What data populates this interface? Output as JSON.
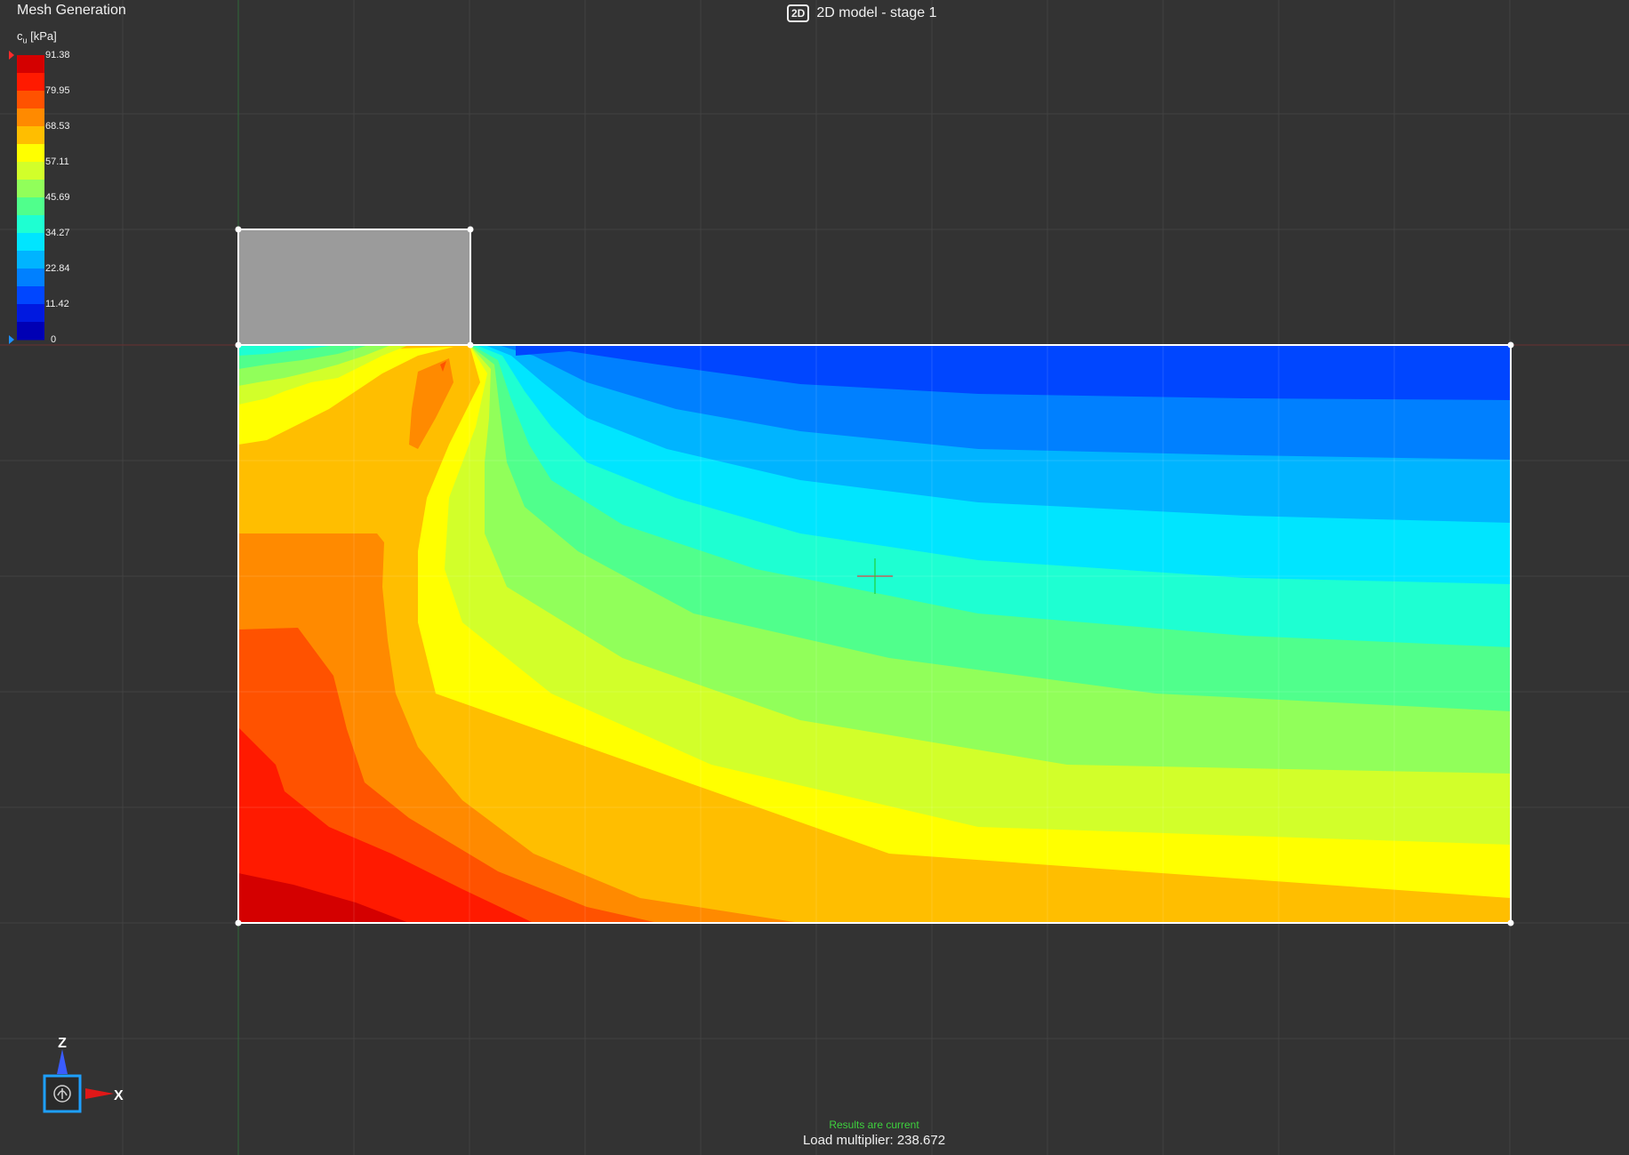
{
  "app": {
    "section_title": "Mesh Generation",
    "model_badge": "2D",
    "model_title": "2D model - stage 1"
  },
  "legend": {
    "quantity": "c",
    "subscript": "u",
    "unit": " [kPa]",
    "labels": [
      "91.38",
      "79.95",
      "68.53",
      "57.11",
      "45.69",
      "34.27",
      "22.84",
      "11.42",
      "0"
    ],
    "colors": [
      "#d40000",
      "#ff1a00",
      "#ff5200",
      "#ff8a00",
      "#ffbe00",
      "#ffff00",
      "#d2ff2a",
      "#91ff5a",
      "#50ff8c",
      "#1effd2",
      "#00e5ff",
      "#00b4ff",
      "#0080ff",
      "#0046ff",
      "#0019e0",
      "#0000b4"
    ],
    "max_marker_color": "#ff2a2a",
    "min_marker_color": "#1e90ff"
  },
  "status": {
    "results": "Results are current",
    "load_multiplier": "Load multiplier: 238.672"
  },
  "axes": {
    "z_label": "Z",
    "x_label": "X",
    "gizmo_color": "#1ea0ff",
    "z_arrow_color": "#3a5cff",
    "x_arrow_color": "#e01818"
  },
  "scene": {
    "background": "#333333",
    "grid_color": "#424242",
    "structure_color": "#9b9b9b",
    "outline_color": "#ffffff"
  }
}
